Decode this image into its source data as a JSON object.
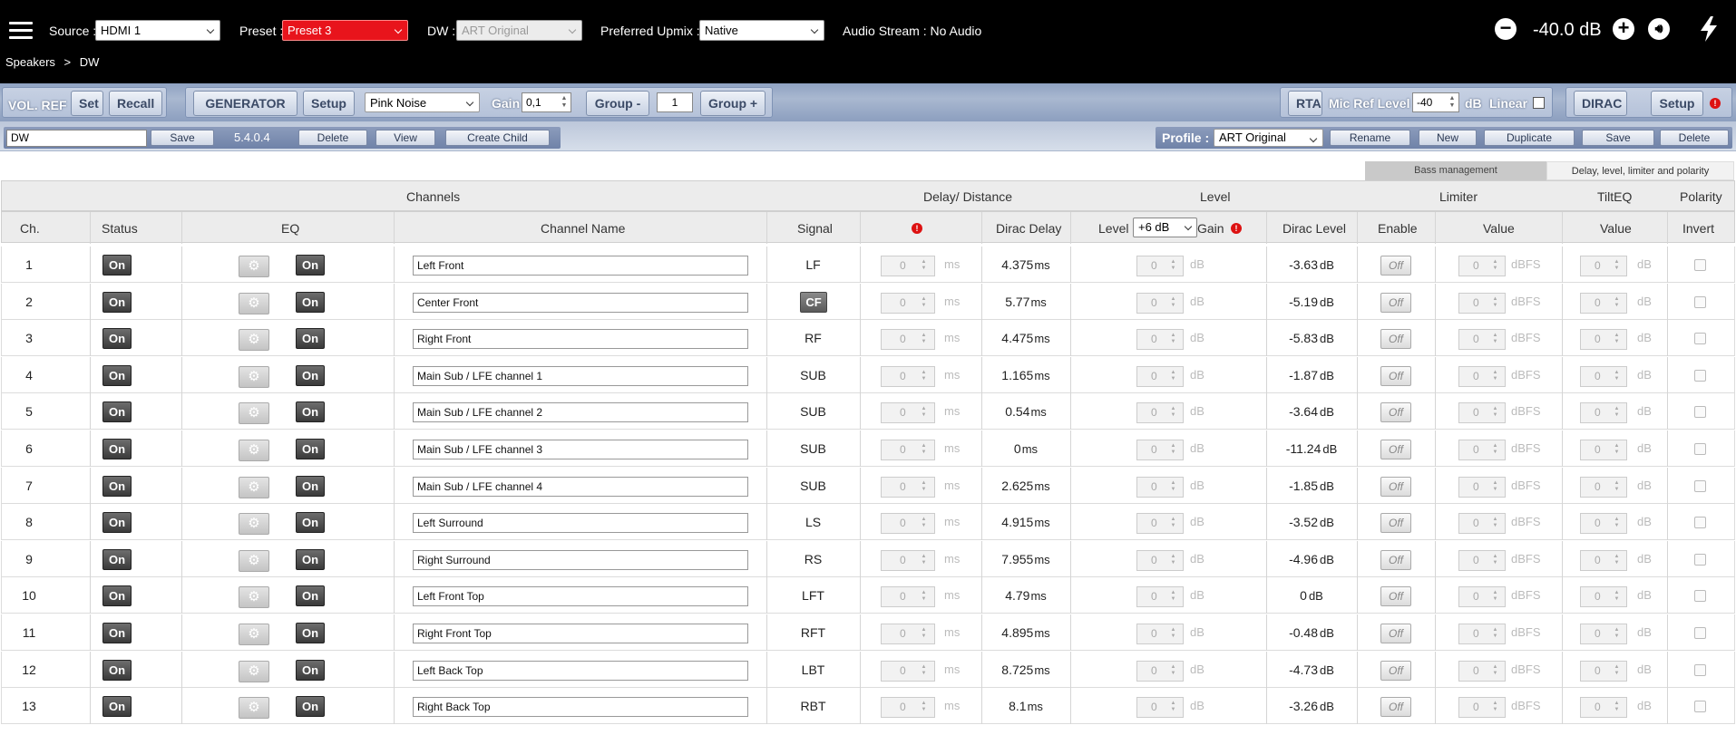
{
  "header": {
    "menu_icon": "hamburger-icon",
    "source_label": "Source :",
    "source_value": "HDMI 1",
    "preset_label": "Preset :",
    "preset_value": "Preset 3",
    "preset_color": "#e8141c",
    "dw_label": "DW :",
    "dw_value": "ART Original",
    "upmix_label": "Preferred Upmix :",
    "upmix_value": "Native",
    "audio_stream": "Audio Stream : No Audio",
    "volume": "-40.0 dB",
    "icons": [
      "minus-icon",
      "plus-icon",
      "speaker-icon",
      "lightning-icon"
    ]
  },
  "breadcrumb": {
    "root": "Speakers",
    "separator": ">",
    "current": "DW"
  },
  "toolbar1": {
    "vol_ref_label": "VOL. REF",
    "set_label": "Set",
    "recall_label": "Recall",
    "generator_label": "GENERATOR",
    "gen_setup_label": "Setup",
    "noise_value": "Pink Noise",
    "gain_label": "Gain",
    "gain_value": "0,1",
    "group_minus_label": "Group -",
    "group_value": "1",
    "group_plus_label": "Group +",
    "rta_label": "RTA",
    "mic_ref_label": "Mic Ref Level",
    "mic_ref_value": "-40",
    "mic_ref_unit": "dB",
    "linear_label": "Linear",
    "dirac_label": "DIRAC",
    "dirac_setup_label": "Setup",
    "warning_mark": "!"
  },
  "toolbar2": {
    "name_value": "DW",
    "save_label": "Save",
    "version": "5.4.0.4",
    "delete_label": "Delete",
    "view_label": "View",
    "create_child_label": "Create Child",
    "profile_label": "Profile :",
    "profile_value": "ART Original",
    "rename_label": "Rename",
    "new_label": "New",
    "duplicate_label": "Duplicate",
    "save2_label": "Save",
    "delete2_label": "Delete"
  },
  "tabs": [
    "Bass management",
    "Delay, level, limiter and polarity"
  ],
  "table": {
    "group_headers": {
      "channels": "Channels",
      "delay": "Delay/ Distance",
      "level": "Level",
      "limiter": "Limiter",
      "tilteq": "TiltEQ",
      "polarity": "Polarity"
    },
    "col_headers": {
      "ch": "Ch.",
      "status": "Status",
      "eq": "EQ",
      "name": "Channel Name",
      "signal": "Signal",
      "dirac_delay": "Dirac Delay",
      "level": "Level",
      "level_select": "+6 dB",
      "gain": "Gain",
      "dirac_level": "Dirac Level",
      "enable": "Enable",
      "limiter_value": "Value",
      "tilt_value": "Value",
      "invert": "Invert"
    },
    "labels": {
      "on": "On",
      "off": "Off",
      "zero": "0",
      "ms": "ms",
      "db": "dB",
      "dbfs": "dBFS"
    },
    "rows": [
      {
        "ch": "1",
        "name": "Left Front",
        "signal": "LF",
        "dirac_delay": "4.375",
        "dirac_level": "-3.63"
      },
      {
        "ch": "2",
        "name": "Center Front",
        "signal": "CF",
        "dirac_delay": "5.77",
        "dirac_level": "-5.19"
      },
      {
        "ch": "3",
        "name": "Right Front",
        "signal": "RF",
        "dirac_delay": "4.475",
        "dirac_level": "-5.83"
      },
      {
        "ch": "4",
        "name": "Main Sub / LFE channel 1",
        "signal": "SUB",
        "dirac_delay": "1.165",
        "dirac_level": "-1.87"
      },
      {
        "ch": "5",
        "name": "Main Sub / LFE channel 2",
        "signal": "SUB",
        "dirac_delay": "0.54",
        "dirac_level": "-3.64"
      },
      {
        "ch": "6",
        "name": "Main Sub / LFE channel 3",
        "signal": "SUB",
        "dirac_delay": "0",
        "dirac_level": "-11.24"
      },
      {
        "ch": "7",
        "name": "Main Sub / LFE channel 4",
        "signal": "SUB",
        "dirac_delay": "2.625",
        "dirac_level": "-1.85"
      },
      {
        "ch": "8",
        "name": "Left Surround",
        "signal": "LS",
        "dirac_delay": "4.915",
        "dirac_level": "-3.52"
      },
      {
        "ch": "9",
        "name": "Right Surround",
        "signal": "RS",
        "dirac_delay": "7.955",
        "dirac_level": "-4.96"
      },
      {
        "ch": "10",
        "name": "Left Front Top",
        "signal": "LFT",
        "dirac_delay": "4.79",
        "dirac_level": "0"
      },
      {
        "ch": "11",
        "name": "Right Front Top",
        "signal": "RFT",
        "dirac_delay": "4.895",
        "dirac_level": "-0.48"
      },
      {
        "ch": "12",
        "name": "Left Back Top",
        "signal": "LBT",
        "dirac_delay": "8.725",
        "dirac_level": "-4.73"
      },
      {
        "ch": "13",
        "name": "Right Back Top",
        "signal": "RBT",
        "dirac_delay": "8.1",
        "dirac_level": "-3.26"
      }
    ]
  }
}
